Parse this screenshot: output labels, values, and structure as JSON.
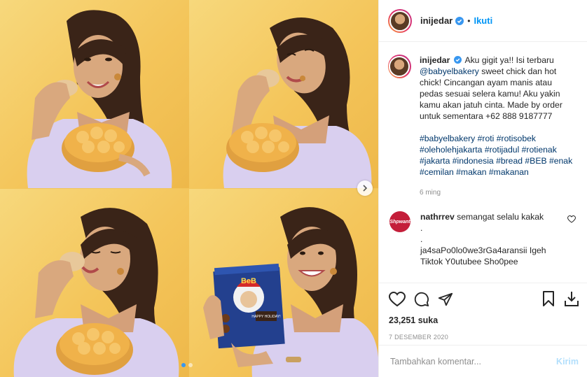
{
  "post": {
    "username": "inijedar",
    "follow_label": "Ikuti",
    "separator": "•",
    "caption": {
      "username": "inijedar",
      "text_before": "Aku gigit ya!! Isi terbaru ",
      "mention": "@babyelbakery",
      "text_after": " sweet chick dan hot chick! Cincangan ayam manis atau pedas sesuai selera kamu! Aku yakin kamu akan jatuh cinta. Made by order untuk sementara +62 888 9187777",
      "hashtags": "#babyelbakery #roti #rotisobek #oleholehjakarta #rotijadul #rotienak #jakarta #indonesia #bread #BEB #enak #cemilan #makan #makanan",
      "time": "6 ming"
    },
    "comments": [
      {
        "username": "nathrrev",
        "avatar_text": "Shpwant",
        "line1": "semangat selalu kakak",
        "line2": ".",
        "line3": ".",
        "line4": "ja4saPo0lo0we3rGa4aransii Igeh Tiktok Y0utubee Sho0pee"
      }
    ],
    "likes": "23,251 suka",
    "date": "7 DESEMBER 2020",
    "comment_placeholder": "Tambahkan komentar...",
    "post_label": "Kirim",
    "carousel": {
      "slides": 4,
      "active": 1
    }
  },
  "box_art": {
    "brand": "BeB",
    "brand_sub": "babyelbakery",
    "greeting": "HAPPY HOLIDAY!"
  },
  "colors": {
    "accent": "#0095f6",
    "background": "#f4c55a",
    "verified": "#3897f0"
  }
}
